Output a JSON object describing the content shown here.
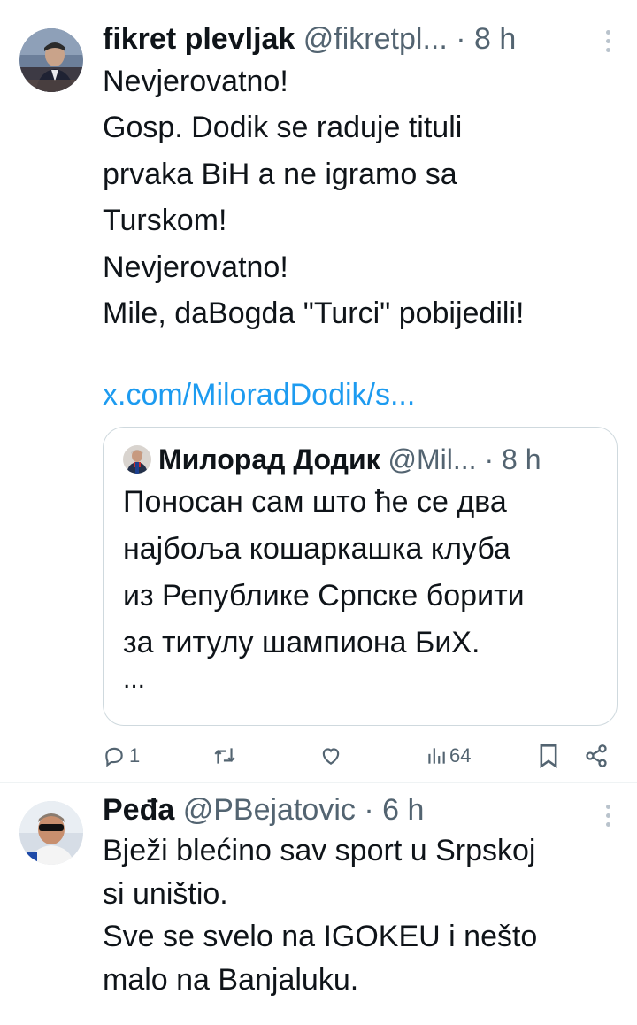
{
  "tweets": [
    {
      "name": "fikret plevljak",
      "handle": "@fikretpl...",
      "dot": "·",
      "time": "8 h",
      "text": "Nevjerovatno!\nGosp. Dodik se raduje tituli\nprvaka BiH a ne igramo sa\nTurskom!\nNevjerovatno!\nMile, daBogda \"Turci\" pobijedili!",
      "link": "x.com/MiloradDodik/s...",
      "quote": {
        "name": "Милорад Додик",
        "handle": "@Mil...",
        "dot": "·",
        "time": "8 h",
        "text": "Поносан сам што ће се два\nнајбоља кошаркашка клуба\nиз Републике Српске борити\nза титулу шампиона БиХ.",
        "ellipsis": "..."
      },
      "actions": {
        "replies": "1",
        "reposts": "",
        "likes": "",
        "views": "64"
      }
    },
    {
      "name": "Peđa",
      "handle": "@PBejatovic",
      "dot": "·",
      "time": "6 h",
      "text": "Bježi blećino sav sport u Srpskoj\nsi uništio.\nSve se svelo na IGOKEU i nešto\nmalo na Banjaluku."
    }
  ],
  "icons": {
    "reply": "reply-icon",
    "repost": "repost-icon",
    "like": "heart-icon",
    "views": "views-icon",
    "bookmark": "bookmark-icon",
    "share": "share-icon",
    "more": "more-icon"
  },
  "colors": {
    "text": "#0f1419",
    "secondary": "#536471",
    "link": "#1d9bf0",
    "border": "#cfd9de"
  }
}
